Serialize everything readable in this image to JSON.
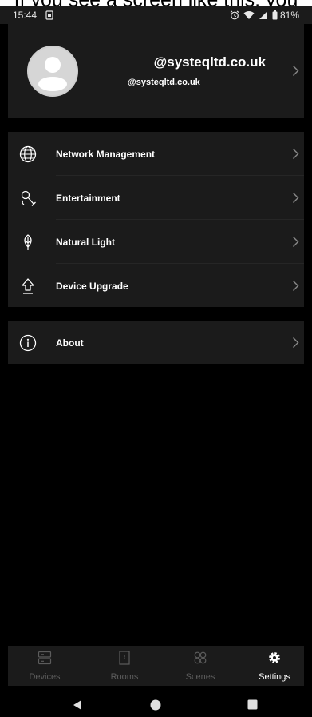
{
  "caption": {
    "text": "If you see a screen like this, you"
  },
  "status_bar": {
    "time": "15:44",
    "battery": "81%"
  },
  "profile": {
    "name": "@systeqltd.co.uk",
    "email": "@systeqltd.co.uk"
  },
  "menu": {
    "network": "Network Management",
    "entertainment": "Entertainment",
    "natural_light": "Natural Light",
    "device_upgrade": "Device Upgrade",
    "about": "About"
  },
  "tabs": {
    "devices": "Devices",
    "rooms": "Rooms",
    "scenes": "Scenes",
    "settings": "Settings"
  },
  "colors": {
    "panel": "#1b1b1b",
    "background": "#000000",
    "text": "#ffffff",
    "inactive": "#5c5c5c"
  }
}
